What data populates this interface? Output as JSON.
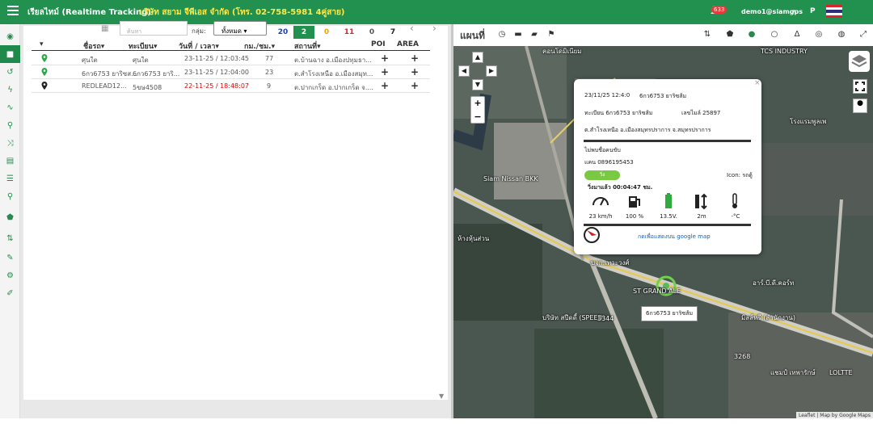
{
  "header": {
    "app_title": "เรียลไทม์ (Realtime Tracking)",
    "company": "บริษัท สยาม จีพีเอส จำกัด (โทร. 02-758-5981 4คู่สาย)",
    "notification_count": "633",
    "user": "demo1@siamgps",
    "lang": "P",
    "accent": "#22904f"
  },
  "sidebar": {
    "icons": [
      "dashboard-icon",
      "truck-icon",
      "history-icon",
      "bolt-icon",
      "chart-icon",
      "search-icon",
      "shuffle-icon",
      "book-icon",
      "list-icon",
      "pin-icon",
      "polygon-icon",
      "route-icon",
      "wrench-icon",
      "gear-icon",
      "edit-icon"
    ]
  },
  "toolbar": {
    "search_placeholder": "ค้นหา",
    "group_label": "กลุ่ม:",
    "group_value": "ทั้งหมด",
    "counts": [
      "20",
      "2",
      "0",
      "11",
      "0",
      "7"
    ]
  },
  "table": {
    "headers": [
      "ชื่อรถ",
      "ทะเบียน",
      "วันที่ / เวลา",
      "กม./ชม.",
      "สถานที่",
      "POI",
      "AREA"
    ],
    "rows": [
      {
        "name": "ศุนใต",
        "plate": "ศุนใต",
        "time": "23-11-25 / 12:03:45",
        "speed": "77",
        "place": "ต.บ้านฉาง อ.เมืองปทุมธา..."
      },
      {
        "name": "6กว6753 ยาริซส...",
        "plate": "6กว6753 ยาริ...",
        "time": "23-11-25 / 12:04:00",
        "speed": "23",
        "place": "ต.สำโรงเหนือ อ.เมืองสมุท..."
      },
      {
        "name": "REDLEAD12...",
        "plate": "5ขษ4508",
        "time": "22-11-25 / 18:48:07",
        "speed": "9",
        "place": "ต.ปากเกร็ด อ.ปากเกร็ด จ...."
      }
    ]
  },
  "map": {
    "title": "แผนที่",
    "labels": [
      "Siam Nissan BKK",
      "ST GRAND ALE",
      "TCS INDUSTRY",
      "ห้างหุ้นส่วน",
      "คอนโดมิเนียม",
      "บจก.เทวะวงศ์",
      "โรงแรมพูลเพ",
      "อาร์.บี.ดี.คอร์ท",
      "บริษัท สปีดดี้ (SPEED)",
      "มิลล์ทรี (สำนักงาน)",
      "แชมป์ เทพารักษ์",
      "3344",
      "3268",
      "LOLTTE"
    ],
    "attribution": "Leaflet | Map by Google Maps"
  },
  "popup": {
    "datetime": "23/11/25 12:4:0",
    "vehicle": "6กว6753 ยาริซส้ม",
    "plate_line": "ทะเบียน 6กว6753 ยาริซส้ม",
    "mileage": "เลขไมล์ 25897",
    "location": "ต.สำโรงเหนือ อ.เมืองสมุทรปราการ จ.สมุทรปราการ",
    "driver": "ไม่พบชื่อคนขับ",
    "phone": "แคน 0896195453",
    "icon_label": "Icon: รถตู้",
    "status": "วิ่ง",
    "running_time": "วิ่งมาแล้ว 00:04:47 ชม.",
    "speed": "23 km/h",
    "fuel": "100 %",
    "battery": "13.5V.",
    "height": "2m",
    "temp": "-°C",
    "map_link": "กดเพื่อแสดงบน google map"
  },
  "vehicle_tag": "6กว6753 ยาริซส้ม"
}
